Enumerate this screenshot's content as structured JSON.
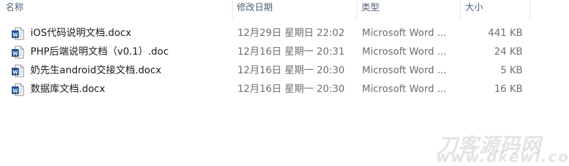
{
  "columns": {
    "name": "名称",
    "date_modified": "修改日期",
    "type": "类型",
    "size": "大小"
  },
  "sort_indicator": "^",
  "files": [
    {
      "name": "iOS代码说明文档.docx",
      "date_modified": "12月29日 星期日 22:02",
      "type": "Microsoft Word ...",
      "size": "441 KB",
      "icon": "word-document-icon"
    },
    {
      "name": "PHP后端说明文档（v0.1）.doc",
      "date_modified": "12月16日 星期一 20:31",
      "type": "Microsoft Word ...",
      "size": "24 KB",
      "icon": "word-document-icon"
    },
    {
      "name": "奶先生android交接文档.docx",
      "date_modified": "12月16日 星期一 20:30",
      "type": "Microsoft Word ...",
      "size": "5 KB",
      "icon": "word-document-icon"
    },
    {
      "name": "数据库文档.docx",
      "date_modified": "12月16日 星期一 20:30",
      "type": "Microsoft Word ...",
      "size": "16 KB",
      "icon": "word-document-icon"
    }
  ],
  "watermark": {
    "line1": "刀客源码网",
    "line2": "www.dkewl.com"
  },
  "colors": {
    "header_text": "#4c607a",
    "name_text": "#1a1a1a",
    "detail_text": "#6d6d6d",
    "word_blue": "#2b579a"
  }
}
